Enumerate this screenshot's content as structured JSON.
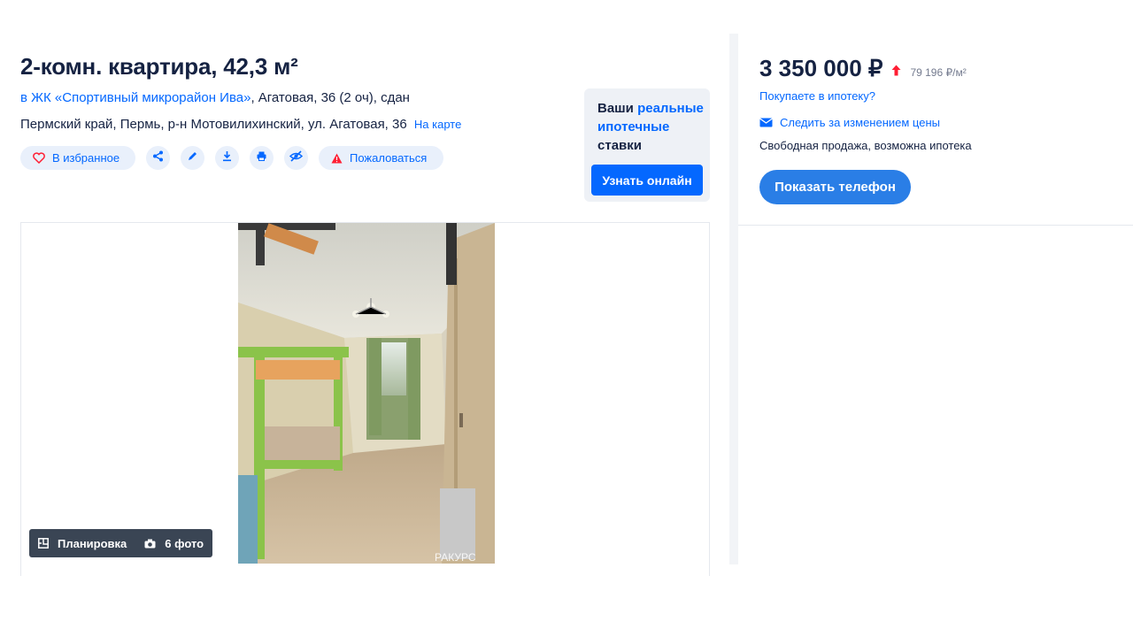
{
  "listing": {
    "title": "2-комн. квартира, 42,3 м²",
    "complex_link": "в ЖК «Спортивный микрорайон Ива»",
    "complex_details": ", Агатовая, 36 (2 оч), сдан",
    "address": "Пермский край, Пермь, р-н Мотовилихинский, ул. Агатовая, 36",
    "map_link": "На карте"
  },
  "actions": {
    "favorite_label": "В избранное",
    "complain_label": "Пожаловаться",
    "icons": [
      "heart-icon",
      "share-icon",
      "edit-icon",
      "download-icon",
      "print-icon",
      "hide-icon",
      "warning-icon"
    ]
  },
  "mortgage_promo": {
    "text_prefix": "Ваши ",
    "text_highlight": "реальные ипотечные",
    "text_suffix": " ставки",
    "button_label": "Узнать онлайн"
  },
  "gallery": {
    "layout_label": "Планировка",
    "photos_label": "6 фото",
    "watermark": "РАКУРС"
  },
  "price_block": {
    "price": "3 350 000 ₽",
    "price_per_m2": "79 196 ₽/м²",
    "mortgage_question": "Покупаете в ипотеку?",
    "follow_price": "Следить за изменением цены",
    "sale_type": "Свободная продажа, возможна ипотека",
    "phone_button": "Показать телефон"
  },
  "colors": {
    "accent": "#0468ff",
    "text": "#152242",
    "price_up": "#ff1f34",
    "phone_button": "#2a7ee6",
    "pill_bg": "#e9f0fb"
  }
}
